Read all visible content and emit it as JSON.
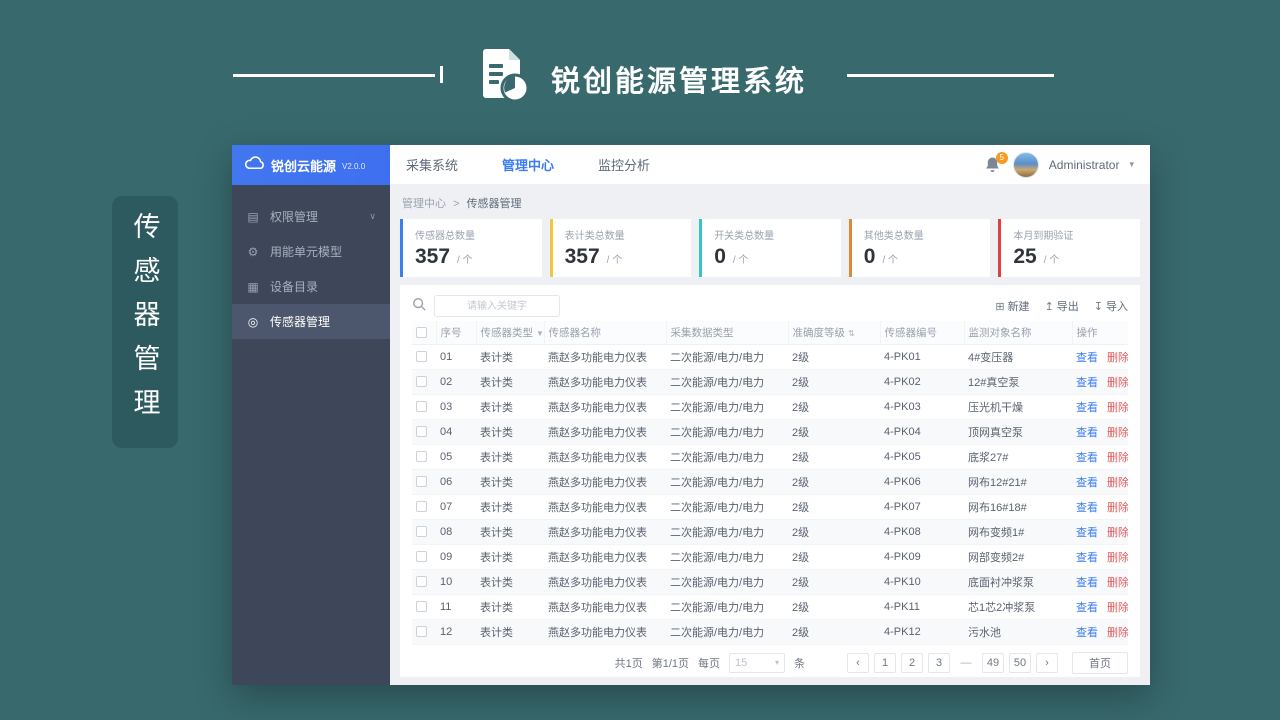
{
  "header": {
    "title": "锐创能源管理系统"
  },
  "side_tag": {
    "text": "传感器管理"
  },
  "sidebar": {
    "logo_text": "锐创云能源",
    "version": "V2.0.0",
    "items": [
      {
        "label": "权限管理",
        "glyph": "▤",
        "chevron": "∨"
      },
      {
        "label": "用能单元模型",
        "glyph": "⚙"
      },
      {
        "label": "设备目录",
        "glyph": "▦"
      },
      {
        "label": "传感器管理",
        "glyph": "◎"
      }
    ]
  },
  "topnav": {
    "items": [
      {
        "label": "采集系统"
      },
      {
        "label": "管理中心"
      },
      {
        "label": "监控分析"
      }
    ],
    "badge_count": "5",
    "username": "Administrator",
    "caret": "▾"
  },
  "breadcrumb": {
    "parent": "管理中心",
    "separator": ">",
    "current": "传感器管理"
  },
  "stats": [
    {
      "label": "传感器总数量",
      "value": "357",
      "unit": "/ 个",
      "color": "#3c7cf5"
    },
    {
      "label": "表计类总数量",
      "value": "357",
      "unit": "/ 个",
      "color": "#f2c53d"
    },
    {
      "label": "开关类总数量",
      "value": "0",
      "unit": "/ 个",
      "color": "#33c5cb"
    },
    {
      "label": "其他类总数量",
      "value": "0",
      "unit": "/ 个",
      "color": "#d8893b"
    },
    {
      "label": "本月到期验证",
      "value": "25",
      "unit": "/ 个",
      "color": "#df4040"
    }
  ],
  "toolbar": {
    "search_placeholder": "请输入关键字",
    "new_label": "新建",
    "new_glyph": "⊞",
    "export_label": "导出",
    "export_glyph": "↥",
    "import_label": "导入",
    "import_glyph": "↧"
  },
  "table": {
    "columns": [
      "序号",
      "传感器类型",
      "传感器名称",
      "采集数据类型",
      "准确度等级",
      "传感器编号",
      "监测对象名称",
      "操作"
    ],
    "filter_glyph": "▼",
    "sort_glyph": "⇅",
    "view_label": "查看",
    "delete_label": "删除",
    "rows": [
      [
        "01",
        "表计类",
        "燕赵多功能电力仪表",
        "二次能源/电力/电力",
        "2级",
        "4-PK01",
        "4#变压器"
      ],
      [
        "02",
        "表计类",
        "燕赵多功能电力仪表",
        "二次能源/电力/电力",
        "2级",
        "4-PK02",
        "12#真空泵"
      ],
      [
        "03",
        "表计类",
        "燕赵多功能电力仪表",
        "二次能源/电力/电力",
        "2级",
        "4-PK03",
        "压光机干燥"
      ],
      [
        "04",
        "表计类",
        "燕赵多功能电力仪表",
        "二次能源/电力/电力",
        "2级",
        "4-PK04",
        "顶网真空泵"
      ],
      [
        "05",
        "表计类",
        "燕赵多功能电力仪表",
        "二次能源/电力/电力",
        "2级",
        "4-PK05",
        "底浆27#"
      ],
      [
        "06",
        "表计类",
        "燕赵多功能电力仪表",
        "二次能源/电力/电力",
        "2级",
        "4-PK06",
        "网布12#21#"
      ],
      [
        "07",
        "表计类",
        "燕赵多功能电力仪表",
        "二次能源/电力/电力",
        "2级",
        "4-PK07",
        "网布16#18#"
      ],
      [
        "08",
        "表计类",
        "燕赵多功能电力仪表",
        "二次能源/电力/电力",
        "2级",
        "4-PK08",
        "网布变频1#"
      ],
      [
        "09",
        "表计类",
        "燕赵多功能电力仪表",
        "二次能源/电力/电力",
        "2级",
        "4-PK09",
        "网部变频2#"
      ],
      [
        "10",
        "表计类",
        "燕赵多功能电力仪表",
        "二次能源/电力/电力",
        "2级",
        "4-PK10",
        "底面衬冲浆泵"
      ],
      [
        "11",
        "表计类",
        "燕赵多功能电力仪表",
        "二次能源/电力/电力",
        "2级",
        "4-PK11",
        "芯1芯2冲浆泵"
      ],
      [
        "12",
        "表计类",
        "燕赵多功能电力仪表",
        "二次能源/电力/电力",
        "2级",
        "4-PK12",
        "污水池"
      ]
    ]
  },
  "pagination": {
    "total_pages": "共1页",
    "current_page": "第1/1页",
    "per_page_label": "每页",
    "per_page_value": "15",
    "per_page_caret": "▾",
    "unit": "条",
    "prev": "‹",
    "next": "›",
    "pages": [
      "1",
      "2",
      "3",
      "—",
      "49",
      "50"
    ],
    "home": "首页"
  }
}
